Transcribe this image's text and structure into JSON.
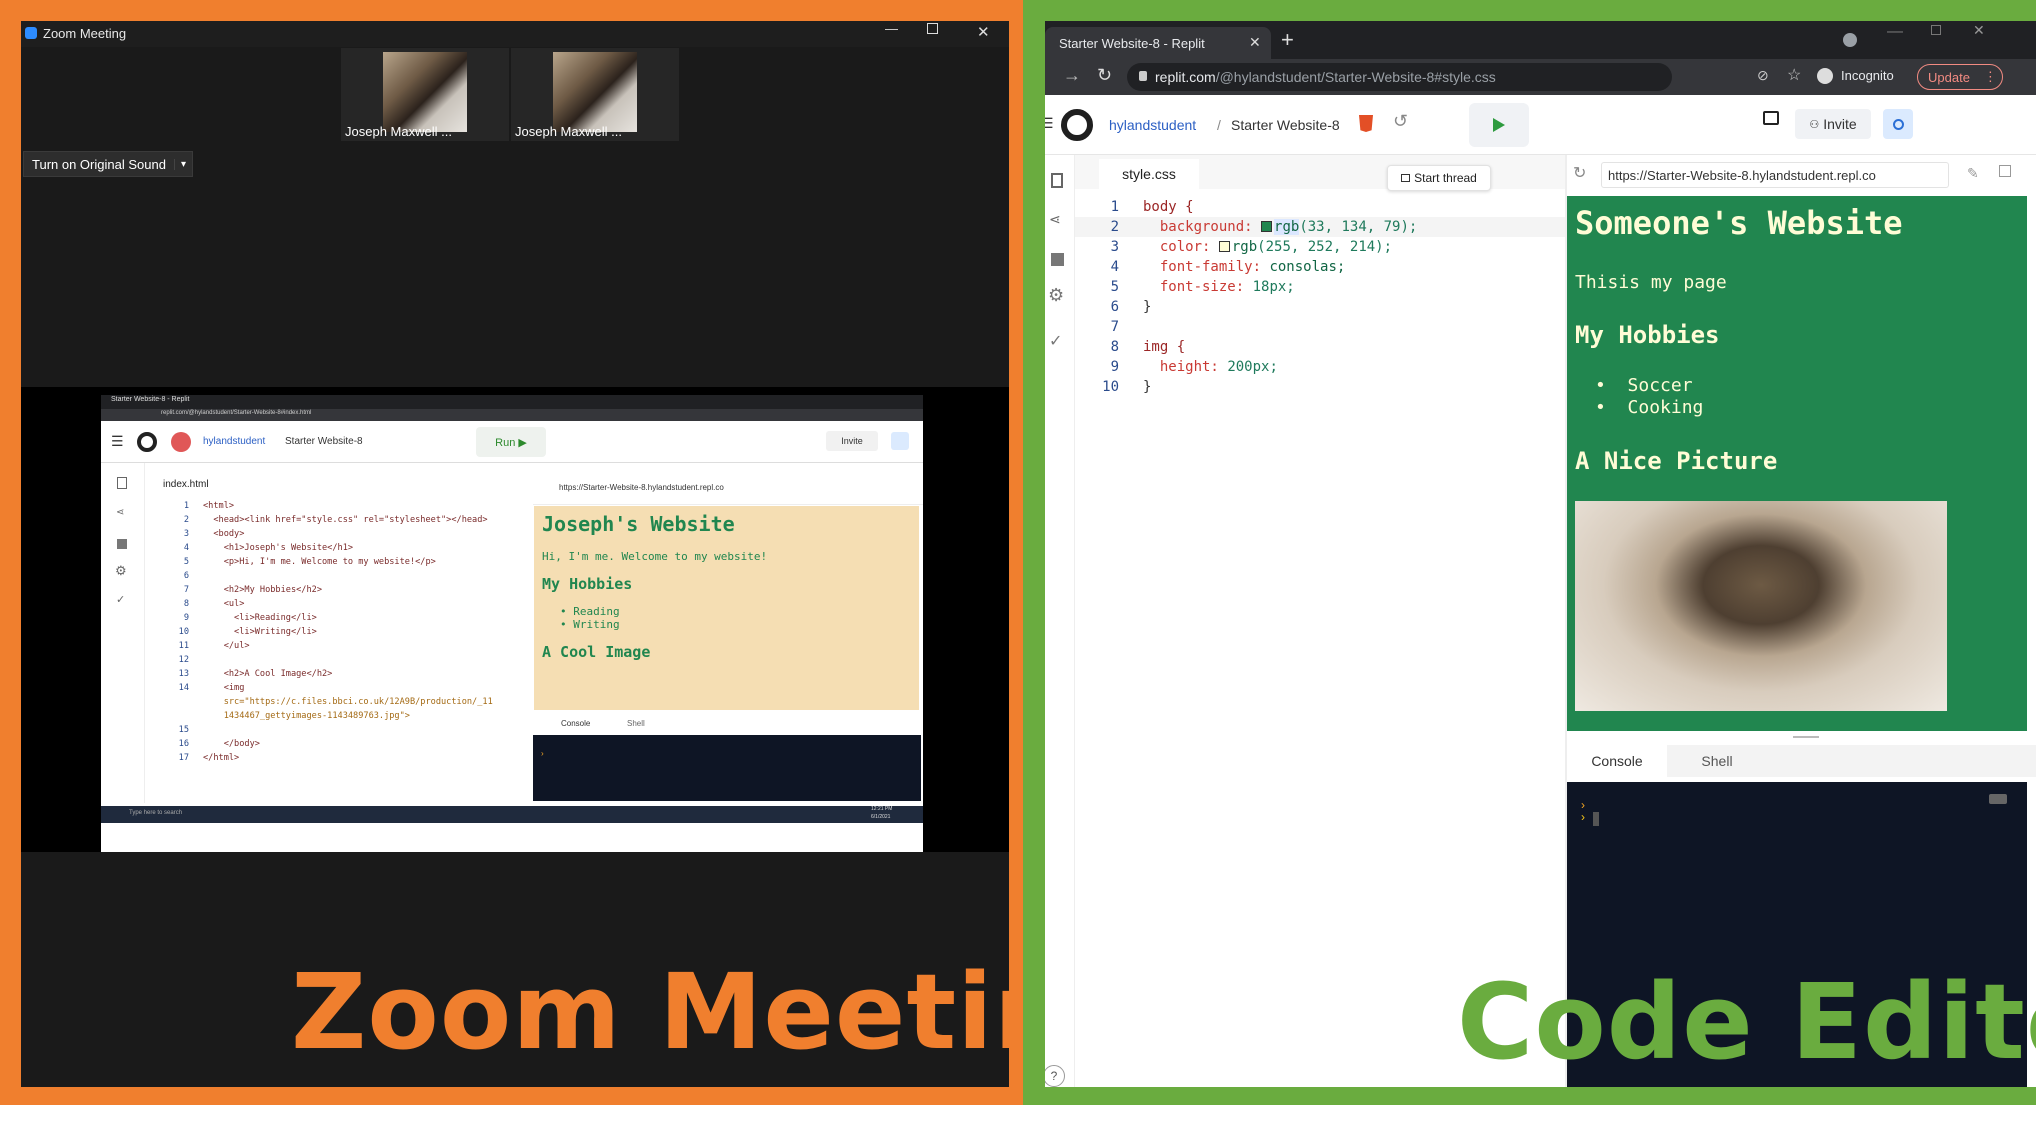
{
  "colors": {
    "zoom_accent": "#f07f2e",
    "editor_accent": "#6aac3f",
    "site_green": "#21864f",
    "site_tan": "#f5deb3"
  },
  "labels": {
    "zoom": "Zoom Meeting",
    "editor": "Code Editor"
  },
  "zoom": {
    "title": "Zoom Meeting",
    "participants": [
      "Joseph Maxwell ...",
      "Joseph Maxwell ..."
    ],
    "original_sound": "Turn on Original Sound",
    "shared": {
      "tab": "Starter Website-8 - Replit",
      "url": "replit.com/@hylandstudent/Starter-Website-8#index.html",
      "user": "hylandstudent",
      "project": "Starter Website-8",
      "run": "Run ▶",
      "invite": "Invite",
      "file_tab": "index.html",
      "preview_url": "https://Starter-Website-8.hylandstudent.repl.co",
      "code": [
        {
          "n": "1",
          "t": "<html>"
        },
        {
          "n": "2",
          "t": "  <head><link href=\"style.css\" rel=\"stylesheet\"></head>"
        },
        {
          "n": "3",
          "t": "  <body>"
        },
        {
          "n": "4",
          "t": "    <h1>Joseph's Website</h1>"
        },
        {
          "n": "5",
          "t": "    <p>Hi, I'm me. Welcome to my website!</p>"
        },
        {
          "n": "6",
          "t": ""
        },
        {
          "n": "7",
          "t": "    <h2>My Hobbies</h2>"
        },
        {
          "n": "8",
          "t": "    <ul>"
        },
        {
          "n": "9",
          "t": "      <li>Reading</li>"
        },
        {
          "n": "10",
          "t": "      <li>Writing</li>"
        },
        {
          "n": "11",
          "t": "    </ul>"
        },
        {
          "n": "12",
          "t": ""
        },
        {
          "n": "13",
          "t": "    <h2>A Cool Image</h2>"
        },
        {
          "n": "14",
          "t": "    <img"
        },
        {
          "n": "",
          "t": "    src=\"https://c.files.bbci.co.uk/12A9B/production/_11"
        },
        {
          "n": "",
          "t": "    1434467_gettyimages-1143489763.jpg\">"
        },
        {
          "n": "15",
          "t": ""
        },
        {
          "n": "16",
          "t": "    </body>"
        },
        {
          "n": "17",
          "t": "</html>"
        }
      ],
      "site": {
        "h1": "Joseph's Website",
        "p": "Hi, I'm me. Welcome to my website!",
        "h2a": "My Hobbies",
        "li": [
          "Reading",
          "Writing"
        ],
        "h2b": "A Cool Image"
      },
      "console_tab": "Console",
      "shell_tab": "Shell",
      "taskbar_search": "Type here to search",
      "time": "12:21 PM",
      "date": "6/1/2021"
    }
  },
  "browser": {
    "tab": "Starter Website-8 - Replit",
    "url_host": "replit.com",
    "url_path": "/@hylandstudent/Starter-Website-8#style.css",
    "incognito": "Incognito",
    "update": "Update"
  },
  "replit": {
    "user": "hylandstudent",
    "project": "Starter Website-8",
    "invite": "Invite",
    "file_tab": "style.css",
    "start_thread": "Start thread",
    "preview_url": "https://Starter-Website-8.hylandstudent.repl.co",
    "console_tab": "Console",
    "shell_tab": "Shell",
    "css": {
      "l1": "body {",
      "l2p": "background:",
      "l2v": "rgb",
      "l2a": "(33, 134, 79);",
      "l3p": "color:",
      "l3v": "rgb",
      "l3a": "(255, 252, 214);",
      "l4p": "font-family:",
      "l4v": "consolas;",
      "l5p": "font-size:",
      "l5v": "18px;",
      "l6": "}",
      "l8": "img {",
      "l9p": "height:",
      "l9v": "200px;",
      "l10": "}"
    },
    "line_numbers": [
      "1",
      "2",
      "3",
      "4",
      "5",
      "6",
      "7",
      "8",
      "9",
      "10"
    ],
    "site": {
      "h1": "Someone's Website",
      "p": "Thisis my page",
      "h2a": "My Hobbies",
      "li": [
        "Soccer",
        "Cooking"
      ],
      "h2b": "A Nice Picture"
    }
  }
}
